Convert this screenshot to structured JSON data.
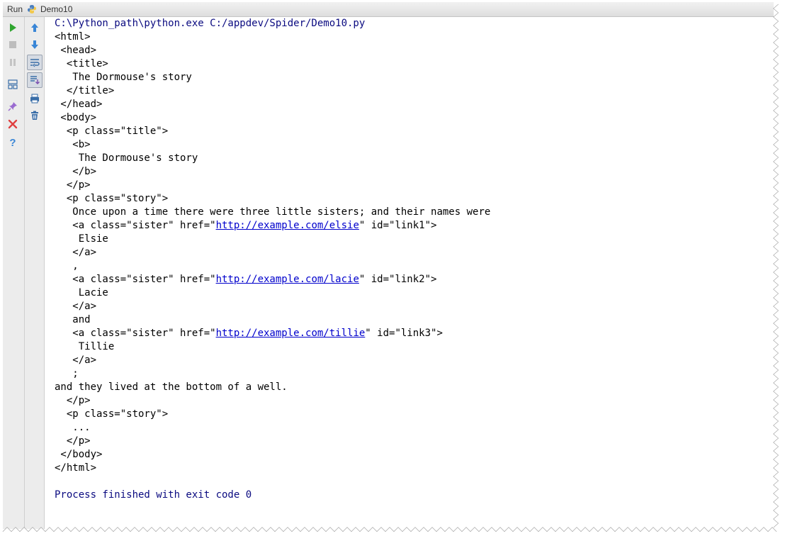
{
  "window": {
    "run_label": "Run",
    "tab_label": "Demo10",
    "python_icon": "python-icon"
  },
  "toolbar": {
    "left": [
      "rerun-icon",
      "stop-icon",
      "pause-icon",
      "layout-icon",
      "pin-icon",
      "close-icon",
      "help-icon"
    ],
    "right": [
      "up-arrow-icon",
      "down-arrow-icon",
      "soft-wrap-icon",
      "scroll-to-end-icon",
      "print-icon",
      "trash-icon"
    ],
    "colors": {
      "run": "#2fa52f",
      "arrow": "#3a86d6",
      "close": "#e04040",
      "help": "#3a86d6",
      "pin": "#9a6bd0"
    }
  },
  "console": {
    "command": "C:\\Python_path\\python.exe C:/appdev/Spider/Demo10.py",
    "output": [
      "<html>",
      " <head>",
      "  <title>",
      "   The Dormouse's story",
      "  </title>",
      " </head>",
      " <body>",
      "  <p class=\"title\">",
      "   <b>",
      "    The Dormouse's story",
      "   </b>",
      "  </p>",
      "  <p class=\"story\">",
      "   Once upon a time there were three little sisters; and their names were",
      {
        "pre": "   <a class=\"sister\" href=\"",
        "link": "http://example.com/elsie",
        "post": "\" id=\"link1\">"
      },
      "    Elsie",
      "   </a>",
      "   ,",
      {
        "pre": "   <a class=\"sister\" href=\"",
        "link": "http://example.com/lacie",
        "post": "\" id=\"link2\">"
      },
      "    Lacie",
      "   </a>",
      "   and",
      {
        "pre": "   <a class=\"sister\" href=\"",
        "link": "http://example.com/tillie",
        "post": "\" id=\"link3\">"
      },
      "    Tillie",
      "   </a>",
      "   ;",
      "and they lived at the bottom of a well.",
      "  </p>",
      "  <p class=\"story\">",
      "   ...",
      "  </p>",
      " </body>",
      "</html>",
      ""
    ],
    "exit_message": "Process finished with exit code 0"
  }
}
